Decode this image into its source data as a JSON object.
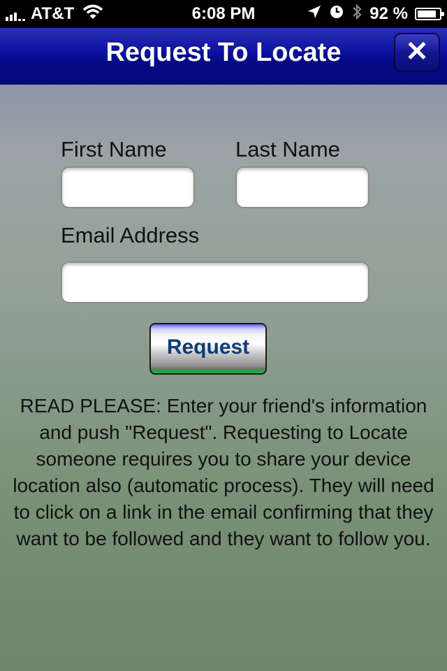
{
  "status_bar": {
    "carrier": "AT&T",
    "time": "6:08 PM",
    "battery_percent": "92 %",
    "icons": [
      "signal-icon",
      "wifi-icon",
      "location-arrow-icon",
      "clock-icon",
      "bluetooth-icon",
      "battery-charging-icon"
    ]
  },
  "nav": {
    "title": "Request To Locate",
    "close_label": "✕"
  },
  "form": {
    "first_name_label": "First Name",
    "last_name_label": "Last Name",
    "email_label": "Email Address",
    "first_name_value": "",
    "last_name_value": "",
    "email_value": "",
    "request_label": "Request"
  },
  "notice": {
    "text": "READ PLEASE:  Enter your friend's information and push \"Request\".  Requesting to Locate someone requires you to share your device location also (automatic process).  They will need to click on a link in the email confirming that they want to be followed and they want to follow you."
  },
  "colors": {
    "nav_bar": "#0c10a2",
    "request_text": "#0c3d75",
    "request_accent": "#22b23a"
  }
}
